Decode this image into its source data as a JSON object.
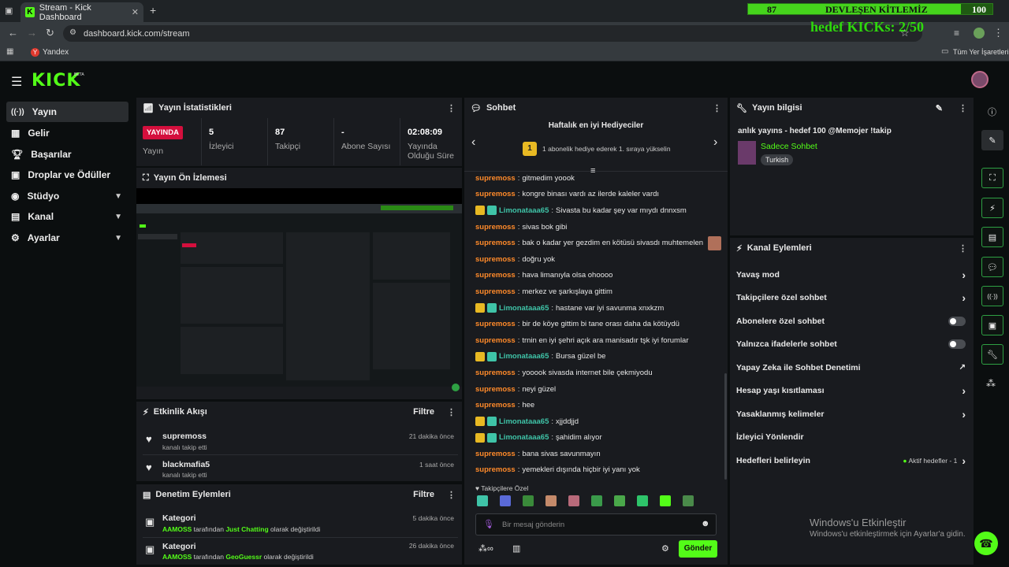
{
  "browser": {
    "tab_title": "Stream - Kick Dashboard",
    "url": "dashboard.kick.com/stream",
    "bookmark": "Yandex",
    "bookmarks_folder": "Tüm Yer İşaretleri"
  },
  "overlay": {
    "goal_current": "87",
    "goal_title": "DEVLEŞEN KİTLEMİZ",
    "goal_target": "100",
    "goal_progress": 0.87,
    "kicks_text": "hedef KICKs: 2/50"
  },
  "brand": {
    "logo": "KICK",
    "beta": "BETA",
    "accent": "#53fc18"
  },
  "sidebar": {
    "items": [
      {
        "label": "Yayın",
        "icon": "broadcast-icon"
      },
      {
        "label": "Gelir",
        "icon": "revenue-icon"
      },
      {
        "label": "Başarılar",
        "icon": "trophy-icon"
      },
      {
        "label": "Droplar ve Ödüller",
        "icon": "gift-icon"
      },
      {
        "label": "Stüdyo",
        "icon": "studio-icon"
      },
      {
        "label": "Kanal",
        "icon": "channel-icon"
      },
      {
        "label": "Ayarlar",
        "icon": "gear-icon"
      }
    ]
  },
  "stats": {
    "title": "Yayın İstatistikleri",
    "live_badge": "YAYINDA",
    "live_label": "Yayın",
    "viewers_value": "5",
    "viewers_label": "İzleyici",
    "followers_value": "87",
    "followers_label": "Takipçi",
    "subs_value": "-",
    "subs_label": "Abone Sayısı",
    "duration_value": "02:08:09",
    "duration_label": "Yayında Olduğu Süre"
  },
  "preview": {
    "title": "Yayın Ön İzlemesi"
  },
  "activity": {
    "title": "Etkinlik Akışı",
    "filter": "Filtre",
    "items": [
      {
        "user": "supremoss",
        "action": "kanalı takip etti",
        "time": "21 dakika önce"
      },
      {
        "user": "blackmafia5",
        "action": "kanalı takip etti",
        "time": "1 saat önce"
      }
    ]
  },
  "moderation": {
    "title": "Denetim Eylemleri",
    "filter": "Filtre",
    "items": [
      {
        "title": "Kategori",
        "actor": "AAMOSS",
        "mid": " tarafından ",
        "target": "Just Chatting",
        "tail": " olarak değiştirildi",
        "time": "5 dakika önce"
      },
      {
        "title": "Kategori",
        "actor": "AAMOSS",
        "mid": " tarafından ",
        "target": "GeoGuessr",
        "tail": " olarak değiştirildi",
        "time": "26 dakika önce"
      }
    ]
  },
  "chat": {
    "title": "Sohbet",
    "gifters_title": "Haftalık en iyi Hediyeciler",
    "gifters_text": "1 abonelik hediye ederek 1. sıraya yükselin",
    "gifters_rank": "1",
    "messages": [
      {
        "user": "supremoss",
        "text": "gitmedim yoook",
        "color": "o",
        "badges": false
      },
      {
        "user": "supremoss",
        "text": "kongre binası vardı az ilerde kaleler vardı",
        "color": "o",
        "badges": false
      },
      {
        "user": "Limonataaa65",
        "text": "Sivasta bu kadar şey var mıydı dnnxsm",
        "color": "g",
        "badges": true
      },
      {
        "user": "supremoss",
        "text": "sivas bok gibi",
        "color": "o",
        "badges": false
      },
      {
        "user": "supremoss",
        "text": "bak o kadar yer gezdim en kötüsü sivasdı muhtemelen",
        "color": "o",
        "badges": false,
        "emote": true
      },
      {
        "user": "supremoss",
        "text": "doğru yok",
        "color": "o",
        "badges": false
      },
      {
        "user": "supremoss",
        "text": "hava limanıyla olsa ohoooo",
        "color": "o",
        "badges": false
      },
      {
        "user": "supremoss",
        "text": "merkez ve şarkışlaya gittim",
        "color": "o",
        "badges": false
      },
      {
        "user": "Limonataaa65",
        "text": "hastane var iyi savunma xnxkzm",
        "color": "g",
        "badges": true
      },
      {
        "user": "supremoss",
        "text": "bir de köye gittim bi tane orası daha da kötüydü",
        "color": "o",
        "badges": false
      },
      {
        "user": "supremoss",
        "text": "trnin en iyi şehri açık ara manisadır tşk iyi forumlar",
        "color": "o",
        "badges": false
      },
      {
        "user": "Limonataaa65",
        "text": "Bursa güzel be",
        "color": "g",
        "badges": true
      },
      {
        "user": "supremoss",
        "text": "yooook sivasda internet bile çekmiyodu",
        "color": "o",
        "badges": false
      },
      {
        "user": "supremoss",
        "text": "neyi güzel",
        "color": "o",
        "badges": false
      },
      {
        "user": "supremoss",
        "text": "hee",
        "color": "o",
        "badges": false
      },
      {
        "user": "Limonataaa65",
        "text": "xjjddjjd",
        "color": "g",
        "badges": true
      },
      {
        "user": "Limonataaa65",
        "text": "şahidim alıyor",
        "color": "g",
        "badges": true
      },
      {
        "user": "supremoss",
        "text": "bana sivas savunmayın",
        "color": "o",
        "badges": false
      },
      {
        "user": "supremoss",
        "text": "yemekleri dışında hiçbir iyi yanı yok",
        "color": "o",
        "badges": false
      }
    ],
    "emotes_label": "Takipçilere Özel",
    "input_placeholder": "Bir mesaj gönderin",
    "send": "Gönder"
  },
  "stream_info": {
    "title": "Yayın bilgisi",
    "stream_title": "anlık yayıns - hedef 100 @Memojer !takip",
    "category": "Sadece Sohbet",
    "language": "Turkish"
  },
  "channel_actions": {
    "title": "Kanal Eylemleri",
    "items": [
      {
        "label": "Yavaş mod",
        "control": "chevron"
      },
      {
        "label": "Takipçilere özel sohbet",
        "control": "chevron"
      },
      {
        "label": "Abonelere özel sohbet",
        "control": "toggle"
      },
      {
        "label": "Yalnızca ifadelerle sohbet",
        "control": "toggle"
      },
      {
        "label": "Yapay Zeka ile Sohbet Denetimi",
        "control": "external"
      },
      {
        "label": "Hesap yaşı kısıtlaması",
        "control": "chevron"
      },
      {
        "label": "Yasaklanmış kelimeler",
        "control": "chevron"
      },
      {
        "label": "İzleyici Yönlendir",
        "control": "none"
      },
      {
        "label": "Hedefleri belirleyin",
        "control": "chevron",
        "extra": "Aktif hedefler - 1"
      }
    ]
  },
  "watermark": {
    "line1": "Windows'u Etkinleştir",
    "line2": "Windows'u etkinleştirmek için Ayarlar'a gidin."
  }
}
